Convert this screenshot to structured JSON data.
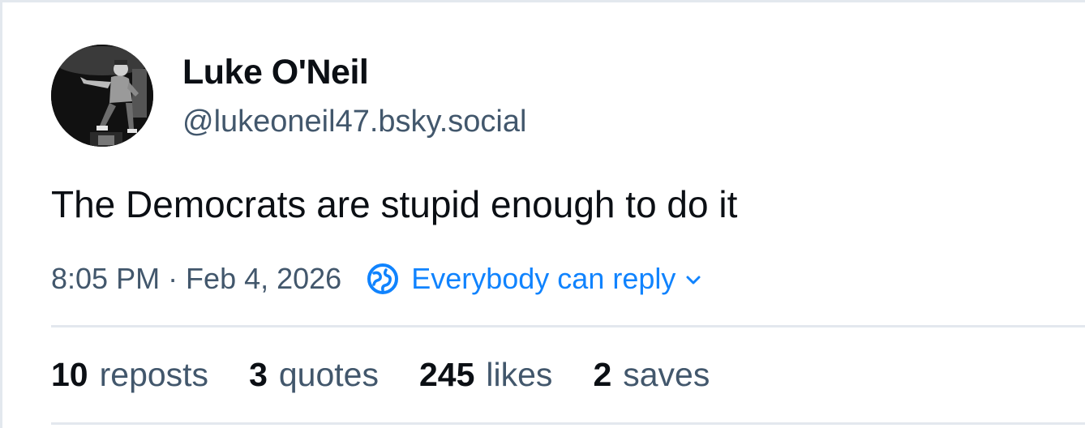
{
  "author": {
    "display_name": "Luke O'Neil",
    "handle": "@lukeoneil47.bsky.social"
  },
  "post": {
    "text": "The Democrats are stupid enough to do it",
    "timestamp": "8:05 PM · Feb 4, 2026",
    "reply_setting": "Everybody can reply"
  },
  "stats": [
    {
      "count": "10",
      "label": "reposts"
    },
    {
      "count": "3",
      "label": "quotes"
    },
    {
      "count": "245",
      "label": "likes"
    },
    {
      "count": "2",
      "label": "saves"
    }
  ],
  "colors": {
    "accent": "#1083fe",
    "text_primary": "#0b0f14",
    "text_secondary": "#42576c",
    "border": "#e3e8ee"
  },
  "icons": {
    "reply_setting": "globe-icon",
    "dropdown": "chevron-down-icon"
  }
}
